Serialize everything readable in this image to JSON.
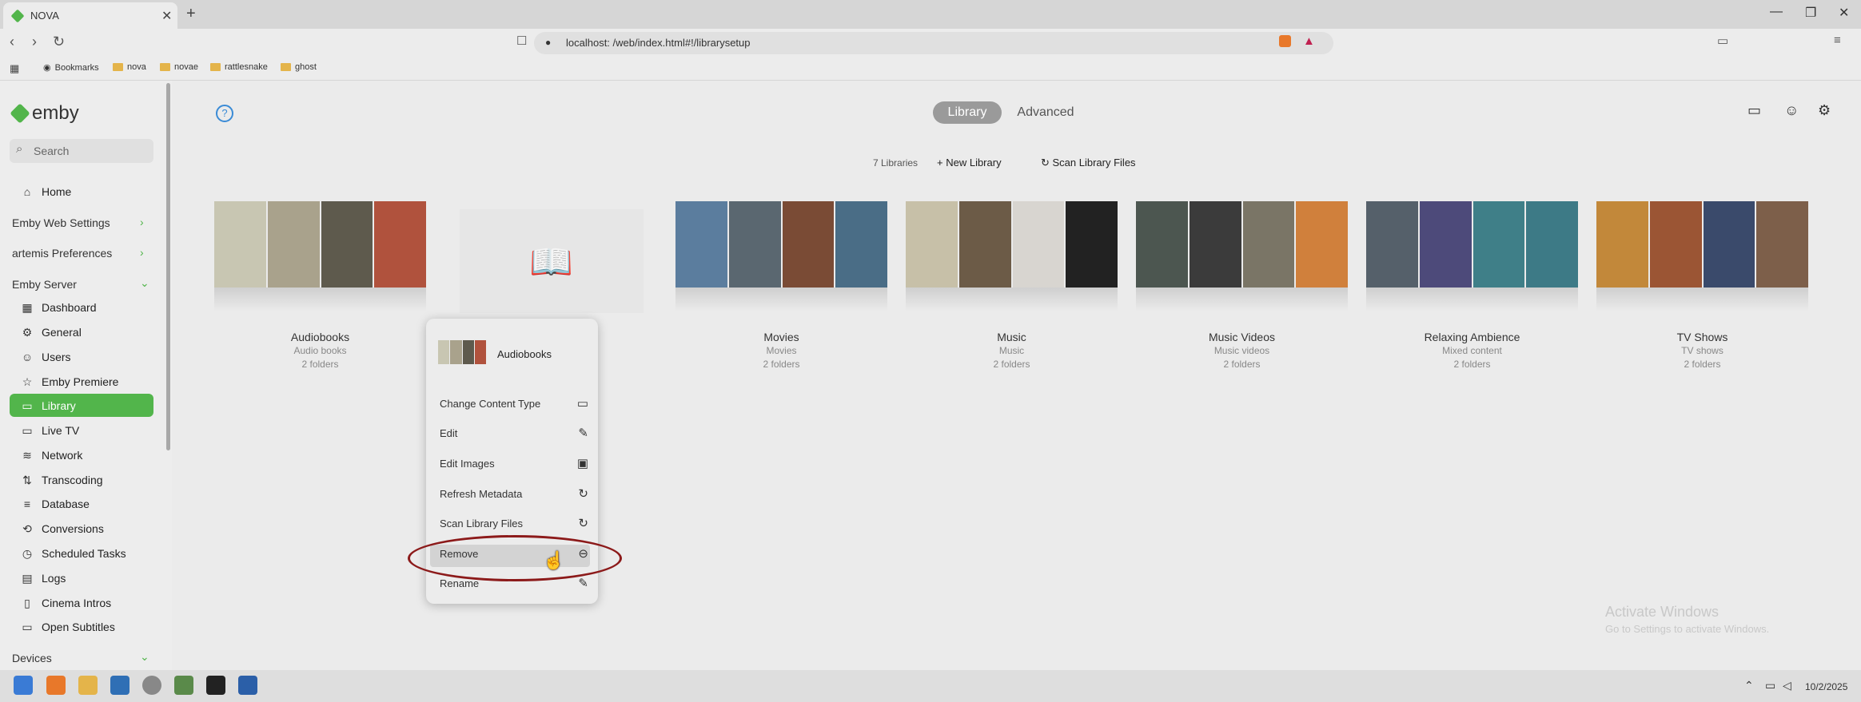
{
  "browser": {
    "tab_title": "NOVA",
    "tab_close": "✕",
    "new_tab": "+",
    "url": "localhost:  /web/index.html#!/librarysetup",
    "bookmarks": [
      "Bookmarks",
      "nova",
      "novae",
      "rattlesnake",
      "ghost"
    ],
    "window_controls": [
      "—",
      "❐",
      "✕"
    ]
  },
  "sidebar": {
    "brand": "emby",
    "search_placeholder": "Search",
    "home": "Home",
    "sections": {
      "web_settings": "Emby Web Settings",
      "preferences": "artemis Preferences",
      "server": "Emby Server",
      "devices": "Devices"
    },
    "items": [
      {
        "label": "Dashboard",
        "icon": "grid-icon"
      },
      {
        "label": "General",
        "icon": "gear-icon"
      },
      {
        "label": "Users",
        "icon": "users-icon"
      },
      {
        "label": "Emby Premiere",
        "icon": "star-icon"
      },
      {
        "label": "Library",
        "icon": "folder-icon"
      },
      {
        "label": "Live TV",
        "icon": "tv-icon"
      },
      {
        "label": "Network",
        "icon": "wifi-icon"
      },
      {
        "label": "Transcoding",
        "icon": "transcode-icon"
      },
      {
        "label": "Database",
        "icon": "database-icon"
      },
      {
        "label": "Conversions",
        "icon": "convert-icon"
      },
      {
        "label": "Scheduled Tasks",
        "icon": "clock-icon"
      },
      {
        "label": "Logs",
        "icon": "logs-icon"
      },
      {
        "label": "Cinema Intros",
        "icon": "film-icon"
      },
      {
        "label": "Open Subtitles",
        "icon": "subtitles-icon"
      }
    ],
    "active_item": "Library"
  },
  "header": {
    "tabs": [
      "Library",
      "Advanced"
    ],
    "active_tab": "Library"
  },
  "toolbar": {
    "count": "7 Libraries",
    "new_library": "New Library",
    "scan_files": "Scan Library Files"
  },
  "libraries": [
    {
      "name": "Audiobooks",
      "type": "Audio books",
      "folders": "2 folders"
    },
    {
      "name": "Movies",
      "type": "Movies",
      "folders": "2 folders"
    },
    {
      "name": "Music",
      "type": "Music",
      "folders": "2 folders"
    },
    {
      "name": "Music Videos",
      "type": "Music videos",
      "folders": "2 folders"
    },
    {
      "name": "Relaxing Ambience",
      "type": "Mixed content",
      "folders": "2 folders"
    },
    {
      "name": "TV Shows",
      "type": "TV shows",
      "folders": "2 folders"
    }
  ],
  "context_menu": {
    "title": "Audiobooks",
    "items": [
      {
        "label": "Change Content Type",
        "icon": "folder-icon"
      },
      {
        "label": "Edit",
        "icon": "pencil-icon"
      },
      {
        "label": "Edit Images",
        "icon": "image-icon"
      },
      {
        "label": "Refresh Metadata",
        "icon": "refresh-icon"
      },
      {
        "label": "Scan Library Files",
        "icon": "refresh-icon"
      },
      {
        "label": "Remove",
        "icon": "minus-circle-icon"
      },
      {
        "label": "Rename",
        "icon": "pencil-icon"
      }
    ],
    "highlighted": "Remove"
  },
  "watermark": {
    "line1": "Activate Windows",
    "line2": "Go to Settings to activate Windows."
  },
  "taskbar": {
    "date": "10/2/2025"
  },
  "colors": {
    "accent": "#52b54b",
    "annotation": "#8c1a1a"
  }
}
